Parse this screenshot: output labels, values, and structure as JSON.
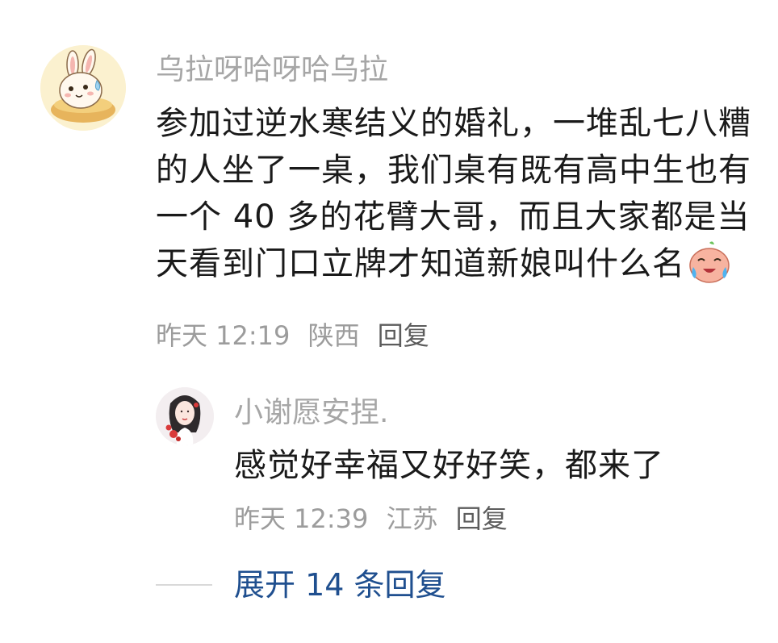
{
  "comment": {
    "username": "乌拉呀哈呀哈乌拉",
    "text_lines": [
      "参加过逆水寒结义的婚礼，一堆乱七八糟",
      "的人坐了一桌，我们桌有既有高中生也有",
      "一个 40 多的花臂大哥，而且大家都是当",
      "天看到门口立牌才知道新娘叫什么名"
    ],
    "emoji": "crying-laughing-emoji",
    "time": "昨天 12:19",
    "location": "陕西",
    "reply_label": "回复"
  },
  "reply": {
    "username": "小谢愿安捏.",
    "text": "感觉好幸福又好好笑，都来了",
    "time": "昨天 12:39",
    "location": "江苏",
    "reply_label": "回复"
  },
  "expand": {
    "label": "展开 14 条回复"
  },
  "colors": {
    "username": "#a6a6a6",
    "meta": "#9c9c9c",
    "link": "#1f4f8f",
    "text": "#1a1a1a"
  }
}
